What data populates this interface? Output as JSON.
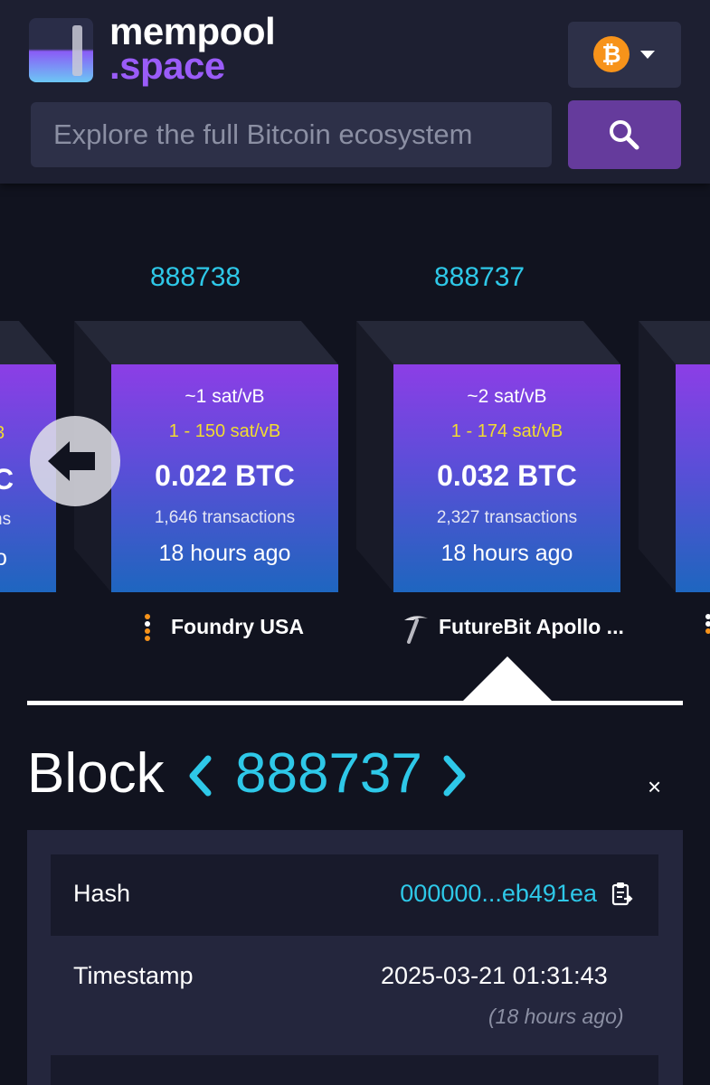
{
  "header": {
    "logo_line1": "mempool",
    "logo_line2": ".space",
    "network_icon": "bitcoin-icon",
    "search_placeholder": "Explore the full Bitcoin ecosystem"
  },
  "blocks": [
    {
      "height": "888738",
      "median_fee": "~1 sat/vB",
      "fee_span": "1 - 150 sat/vB",
      "total": "0.022 BTC",
      "tx_count": "1,646 transactions",
      "time": "18 hours ago",
      "pool": "Foundry USA"
    },
    {
      "height": "888737",
      "median_fee": "~2 sat/vB",
      "fee_span": "1 - 174 sat/vB",
      "total": "0.032 BTC",
      "tx_count": "2,327 transactions",
      "time": "18 hours ago",
      "pool": "FutureBit Apollo ..."
    }
  ],
  "partial_block": {
    "fee_span": "3",
    "total": "C",
    "tx_count": "ns",
    "time": "o"
  },
  "detail": {
    "title": "Block",
    "height": "888737",
    "close": "×",
    "hash_label": "Hash",
    "hash_value": "000000...eb491ea",
    "timestamp_label": "Timestamp",
    "timestamp_value": "2025-03-21 01:31:43",
    "timestamp_relative": "(18 hours ago)"
  },
  "colors": {
    "background": "#11131f",
    "header": "#1d1f31",
    "accent_cyan": "#2ec8e8",
    "fee_yellow": "#f2dc30",
    "search_button": "#653b9c",
    "bitcoin_orange": "#f7931a"
  }
}
